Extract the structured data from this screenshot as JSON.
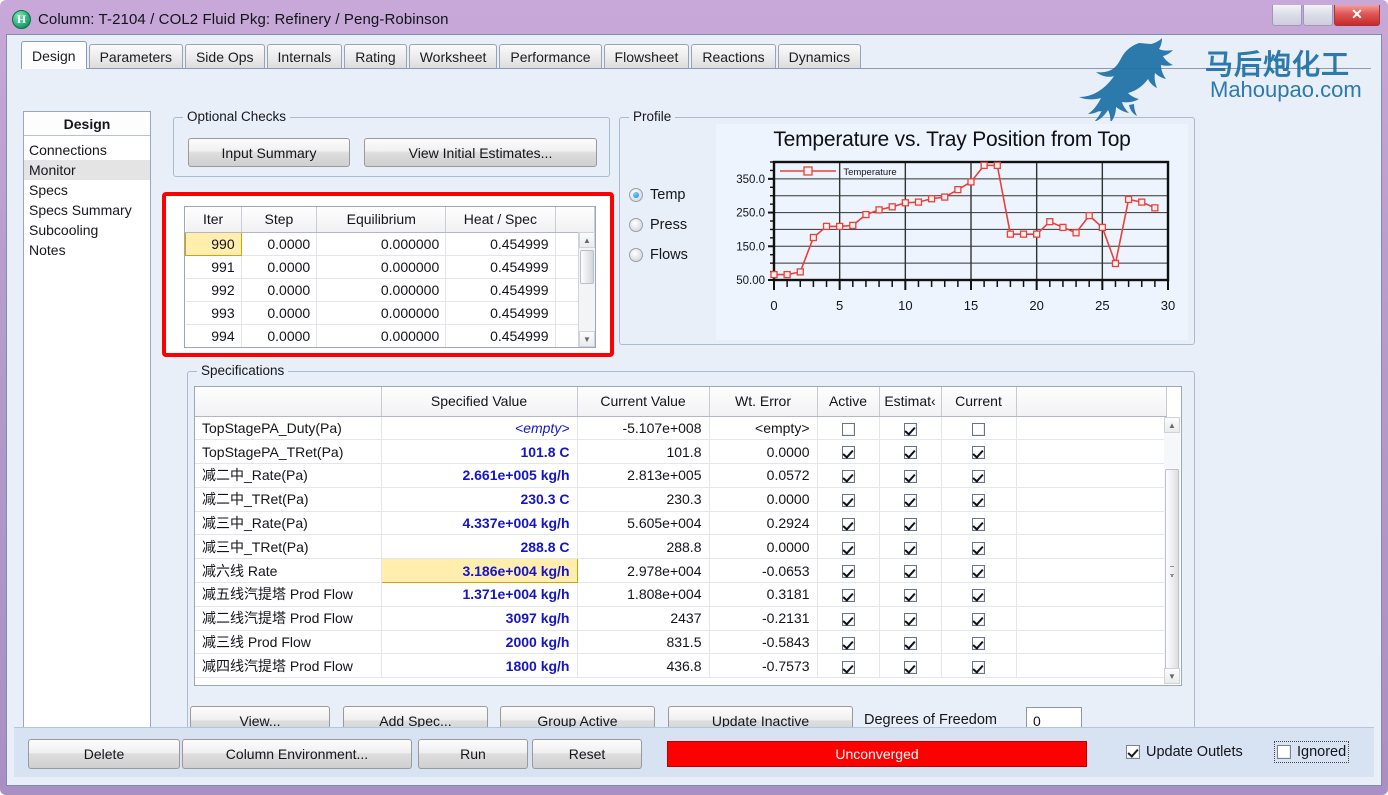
{
  "window": {
    "icon": "hysys-h-icon",
    "title": "Column: T-2104 / COL2  Fluid Pkg: Refinery / Peng-Robinson",
    "buttons": {
      "minimize": "",
      "maximize": "",
      "close": "✕"
    }
  },
  "watermark": {
    "chinese": "马后炮化工",
    "english": "Mahoupao.com"
  },
  "tabs": [
    {
      "label": "Design",
      "active": true
    },
    {
      "label": "Parameters",
      "active": false
    },
    {
      "label": "Side Ops",
      "active": false
    },
    {
      "label": "Internals",
      "active": false
    },
    {
      "label": "Rating",
      "active": false
    },
    {
      "label": "Worksheet",
      "active": false
    },
    {
      "label": "Performance",
      "active": false
    },
    {
      "label": "Flowsheet",
      "active": false
    },
    {
      "label": "Reactions",
      "active": false
    },
    {
      "label": "Dynamics",
      "active": false
    }
  ],
  "sidebar": {
    "header": "Design",
    "items": [
      {
        "label": "Connections",
        "selected": false
      },
      {
        "label": "Monitor",
        "selected": true
      },
      {
        "label": "Specs",
        "selected": false
      },
      {
        "label": "Specs Summary",
        "selected": false
      },
      {
        "label": "Subcooling",
        "selected": false
      },
      {
        "label": "Notes",
        "selected": false
      }
    ]
  },
  "optional_checks": {
    "legend": "Optional Checks",
    "input_summary": "Input Summary",
    "view_initial_estimates": "View Initial Estimates..."
  },
  "iteration_table": {
    "columns": [
      "Iter",
      "Step",
      "Equilibrium",
      "Heat / Spec",
      ""
    ],
    "rows": [
      {
        "iter": "990",
        "step": "0.0000",
        "equilibrium": "0.000000",
        "heat_spec": "0.454999",
        "selected": true
      },
      {
        "iter": "991",
        "step": "0.0000",
        "equilibrium": "0.000000",
        "heat_spec": "0.454999",
        "selected": false
      },
      {
        "iter": "992",
        "step": "0.0000",
        "equilibrium": "0.000000",
        "heat_spec": "0.454999",
        "selected": false
      },
      {
        "iter": "993",
        "step": "0.0000",
        "equilibrium": "0.000000",
        "heat_spec": "0.454999",
        "selected": false
      },
      {
        "iter": "994",
        "step": "0.0000",
        "equilibrium": "0.000000",
        "heat_spec": "0.454999",
        "selected": false
      }
    ]
  },
  "profile": {
    "legend": "Profile",
    "radios": [
      {
        "label": "Temp",
        "selected": true
      },
      {
        "label": "Press",
        "selected": false
      },
      {
        "label": "Flows",
        "selected": false
      }
    ]
  },
  "chart_data": {
    "type": "line",
    "title": "Temperature vs. Tray Position from Top",
    "xlabel": "",
    "ylabel": "",
    "legend": [
      "Temperature"
    ],
    "legend_position": "top-left-inside",
    "grid": true,
    "xlim": [
      0,
      30
    ],
    "ylim": [
      50,
      400
    ],
    "xticks": [
      0,
      5,
      10,
      15,
      20,
      25,
      30
    ],
    "yticks": [
      "50.00",
      "150.0",
      "250.0",
      "350.0"
    ],
    "series": [
      {
        "name": "Temperature",
        "color": "#e8413c",
        "x": [
          0,
          1,
          2,
          3,
          4,
          5,
          6,
          7,
          8,
          9,
          10,
          11,
          12,
          13,
          14,
          15,
          16,
          17,
          18,
          19,
          20,
          21,
          22,
          23,
          24,
          25,
          26,
          27,
          28,
          29
        ],
        "y": [
          66,
          66,
          74,
          176,
          209,
          209,
          212,
          244,
          258,
          267,
          279,
          281,
          291,
          296,
          318,
          341,
          390,
          390,
          186,
          186,
          186,
          223,
          206,
          190,
          241,
          206,
          99,
          289,
          281,
          264
        ]
      }
    ]
  },
  "specifications": {
    "legend": "Specifications",
    "columns": [
      "",
      "Specified Value",
      "Current Value",
      "Wt. Error",
      "Active",
      "Estimat‹",
      "Current",
      ""
    ],
    "rows": [
      {
        "name": "TopStagePA_Duty(Pa)",
        "specified": "<empty>",
        "spec_empty": true,
        "spec_highlight": false,
        "current": "-5.107e+008",
        "error": "<empty>",
        "active": false,
        "estimate": true,
        "current_chk": false
      },
      {
        "name": "TopStagePA_TRet(Pa)",
        "specified": "101.8 C",
        "spec_empty": false,
        "spec_highlight": false,
        "current": "101.8",
        "error": "0.0000",
        "active": true,
        "estimate": true,
        "current_chk": true
      },
      {
        "name": "减二中_Rate(Pa)",
        "specified": "2.661e+005 kg/h",
        "spec_empty": false,
        "spec_highlight": false,
        "current": "2.813e+005",
        "error": "0.0572",
        "active": true,
        "estimate": true,
        "current_chk": true
      },
      {
        "name": "减二中_TRet(Pa)",
        "specified": "230.3 C",
        "spec_empty": false,
        "spec_highlight": false,
        "current": "230.3",
        "error": "0.0000",
        "active": true,
        "estimate": true,
        "current_chk": true
      },
      {
        "name": "减三中_Rate(Pa)",
        "specified": "4.337e+004 kg/h",
        "spec_empty": false,
        "spec_highlight": false,
        "current": "5.605e+004",
        "error": "0.2924",
        "active": true,
        "estimate": true,
        "current_chk": true
      },
      {
        "name": "减三中_TRet(Pa)",
        "specified": "288.8 C",
        "spec_empty": false,
        "spec_highlight": false,
        "current": "288.8",
        "error": "0.0000",
        "active": true,
        "estimate": true,
        "current_chk": true
      },
      {
        "name": "减六线 Rate",
        "specified": "3.186e+004 kg/h",
        "spec_empty": false,
        "spec_highlight": true,
        "current": "2.978e+004",
        "error": "-0.0653",
        "active": true,
        "estimate": true,
        "current_chk": true
      },
      {
        "name": "减五线汽提塔 Prod Flow",
        "specified": "1.371e+004 kg/h",
        "spec_empty": false,
        "spec_highlight": false,
        "current": "1.808e+004",
        "error": "0.3181",
        "active": true,
        "estimate": true,
        "current_chk": true
      },
      {
        "name": "减二线汽提塔 Prod Flow",
        "specified": "3097 kg/h",
        "spec_empty": false,
        "spec_highlight": false,
        "current": "2437",
        "error": "-0.2131",
        "active": true,
        "estimate": true,
        "current_chk": true
      },
      {
        "name": "减三线 Prod Flow",
        "specified": "2000 kg/h",
        "spec_empty": false,
        "spec_highlight": false,
        "current": "831.5",
        "error": "-0.5843",
        "active": true,
        "estimate": true,
        "current_chk": true
      },
      {
        "name": "减四线汽提塔 Prod Flow",
        "specified": "1800 kg/h",
        "spec_empty": false,
        "spec_highlight": false,
        "current": "436.8",
        "error": "-0.7573",
        "active": true,
        "estimate": true,
        "current_chk": true
      }
    ],
    "buttons": {
      "view": "View...",
      "add_spec": "Add Spec...",
      "group_active": "Group Active",
      "update_inactive": "Update Inactive"
    },
    "degrees_of_freedom_label": "Degrees of Freedom",
    "degrees_of_freedom_value": "0"
  },
  "bottom": {
    "delete": "Delete",
    "column_environment": "Column Environment...",
    "run": "Run",
    "reset": "Reset",
    "status": "Unconverged",
    "status_color": "#ff0000",
    "update_outlets": {
      "label": "Update Outlets",
      "checked": true
    },
    "ignored": {
      "label": "Ignored",
      "checked": false
    }
  }
}
